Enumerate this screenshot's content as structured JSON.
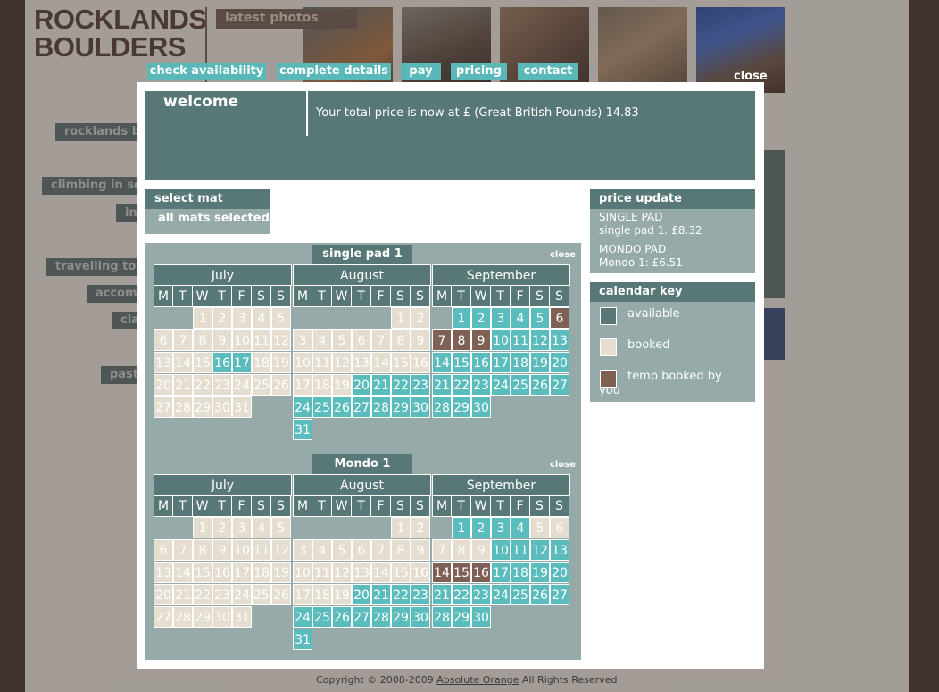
{
  "background": {
    "logo_line1": "ROCKLANDS",
    "logo_line2": "BOULDERS",
    "latest_photos": "latest photos",
    "side_items": [
      "rocklands bo",
      "climbing in sou",
      "in",
      "travelling to r",
      "accom",
      "cla",
      "",
      "past"
    ],
    "copyright_prefix": "Copyright © 2008-2009",
    "copyright_link": "Absolute Orange",
    "copyright_suffix": "All Rights Reserved"
  },
  "nav": {
    "tabs": [
      "check availability",
      "complete details",
      "pay",
      "pricing",
      "contact"
    ],
    "close": "close"
  },
  "welcome": {
    "title": "welcome",
    "price_text": "Your total price is now at £ (Great British Pounds) 14.83"
  },
  "select_mat": {
    "title": "select mat",
    "value": "all mats selected"
  },
  "price_update": {
    "title": "price update",
    "line1": "SINGLE PAD",
    "line2": "single pad 1: £8.32",
    "line3": "MONDO PAD",
    "line4": "Mondo 1: £6.51"
  },
  "calendar_key": {
    "title": "calendar key",
    "available": "available",
    "booked": "booked",
    "temp": "temp booked by you"
  },
  "colors": {
    "available": "#5abcbc",
    "booked": "#e4ddd0",
    "temp": "#7e6055",
    "header": "#587878",
    "panel": "#95aaa9"
  },
  "weekdays": [
    "M",
    "T",
    "W",
    "T",
    "F",
    "S",
    "S"
  ],
  "calendars": [
    {
      "title": "single pad 1",
      "close": "close",
      "months": [
        {
          "name": "July",
          "offset": 2,
          "days": 31,
          "available": [
            16,
            17
          ],
          "temp": []
        },
        {
          "name": "August",
          "offset": 5,
          "days": 31,
          "available": [
            20,
            21,
            22,
            23,
            24,
            25,
            26,
            27,
            28,
            29,
            30,
            31
          ],
          "temp": []
        },
        {
          "name": "September",
          "offset": 1,
          "days": 30,
          "available": [
            1,
            2,
            3,
            4,
            5,
            10,
            11,
            12,
            13,
            14,
            15,
            16,
            17,
            18,
            19,
            20,
            21,
            22,
            23,
            24,
            25,
            26,
            27,
            28,
            29,
            30
          ],
          "temp": [
            6,
            7,
            8,
            9
          ]
        }
      ]
    },
    {
      "title": "Mondo 1",
      "close": "close",
      "months": [
        {
          "name": "July",
          "offset": 2,
          "days": 31,
          "available": [],
          "temp": []
        },
        {
          "name": "August",
          "offset": 5,
          "days": 31,
          "available": [
            20,
            21,
            22,
            23,
            24,
            25,
            26,
            27,
            28,
            29,
            30,
            31
          ],
          "temp": []
        },
        {
          "name": "September",
          "offset": 1,
          "days": 30,
          "available": [
            1,
            2,
            3,
            4,
            10,
            11,
            12,
            13,
            17,
            18,
            19,
            20,
            21,
            22,
            23,
            24,
            25,
            26,
            27,
            28,
            29,
            30
          ],
          "temp": [
            14,
            15,
            16
          ]
        }
      ]
    }
  ]
}
